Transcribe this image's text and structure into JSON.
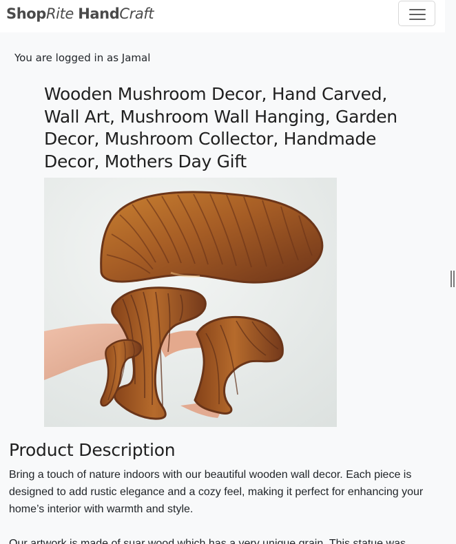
{
  "brand": {
    "part1": "Shop",
    "part2": "Rite",
    "part3": "Hand",
    "part4": "Craft"
  },
  "navigation": {
    "menu_icon": "hamburger-menu-icon"
  },
  "user": {
    "status": "You are logged in as Jamal"
  },
  "product": {
    "title": "Wooden Mushroom Decor, Hand Carved, Wall Art, Mushroom Wall Hanging, Garden Decor, Mushroom Collector, Handmade Decor, Mothers Day Gift",
    "description_heading": "Product Description",
    "description_paragraphs": [
      "Bring a touch of nature indoors with our beautiful wooden wall decor. Each piece is designed to add rustic elegance and a cozy feel, making it perfect for enhancing your home’s interior with warmth and style.",
      "Our artwork is made of suar wood which has a very unique grain. This statue was"
    ]
  },
  "colors": {
    "page_background": "#f8f9fa",
    "navbar_background": "#ffffff",
    "brand_text": "#4a4a4a",
    "body_text": "#212529",
    "wood_main": "#a85f27",
    "wood_dark": "#70391a",
    "image_background": "#e6e9e7"
  }
}
